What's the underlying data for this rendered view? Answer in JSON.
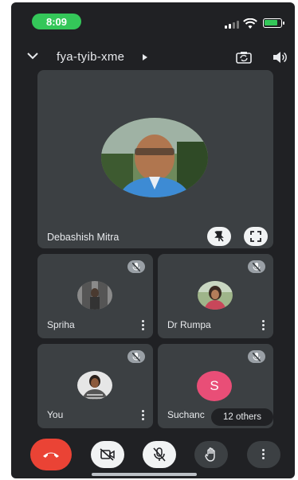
{
  "status_bar": {
    "time": "8:09",
    "battery_color": "#34c759"
  },
  "header": {
    "meeting_code": "fya-tyib-xme",
    "icons": [
      "chevron-down-icon",
      "caret-right-icon",
      "camera-flip-icon",
      "speaker-icon"
    ]
  },
  "main_participant": {
    "name": "Debashish Mitra",
    "icons": [
      "pin-off-icon",
      "fullscreen-icon"
    ]
  },
  "participants": [
    {
      "name": "Spriha",
      "muted": true
    },
    {
      "name": "Dr Rumpa",
      "muted": true
    },
    {
      "name": "You",
      "muted": true
    },
    {
      "name": "Suchanc",
      "initial": "S",
      "muted": true,
      "avatar_color": "#e94e77"
    }
  ],
  "others_label": "12 others",
  "controls": {
    "icons": [
      "end-call-icon",
      "camera-off-icon",
      "mic-off-icon",
      "raise-hand-icon",
      "more-vert-icon"
    ],
    "end_call_color": "#ea4335"
  }
}
